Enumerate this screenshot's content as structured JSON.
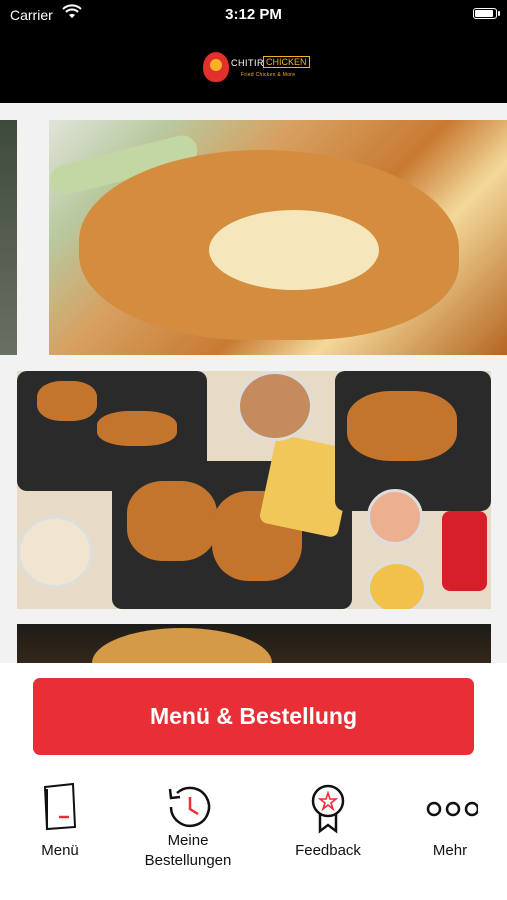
{
  "status_bar": {
    "carrier": "Carrier",
    "time": "3:12 PM",
    "battery_level": 0.9
  },
  "header": {
    "logo": {
      "word1": "CHITIR",
      "word2": "CHICKEN",
      "tagline": "Fried Chicken & More"
    }
  },
  "banners": [
    {
      "name": "stuffed-pastry-banner"
    },
    {
      "name": "fried-chicken-platter-banner"
    },
    {
      "name": "burger-banner"
    }
  ],
  "cta": {
    "label": "Menü & Bestellung"
  },
  "tabs": [
    {
      "label": "Menü",
      "icon": "menu-book-icon"
    },
    {
      "label": "Meine\nBestellungen",
      "icon": "order-history-icon"
    },
    {
      "label": "Feedback",
      "icon": "award-star-icon"
    },
    {
      "label": "Mehr",
      "icon": "more-dots-icon"
    }
  ],
  "colors": {
    "accent": "#e92f36",
    "header_bg": "#000000",
    "feed_bg": "#f2f2f2",
    "logo_yellow": "#f6b126"
  }
}
